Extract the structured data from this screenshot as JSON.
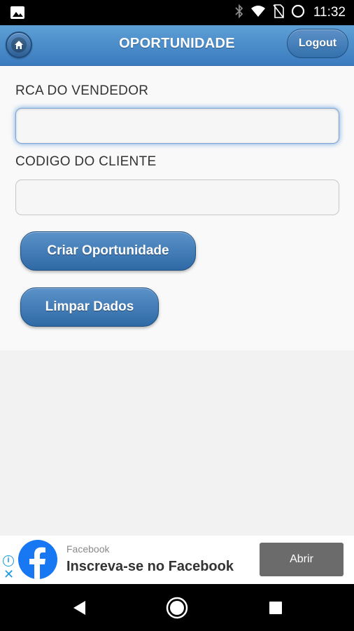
{
  "status_bar": {
    "time": "11:32",
    "icons": [
      "image-icon",
      "bluetooth-icon",
      "wifi-icon",
      "no-sim-icon",
      "battery-saver-icon"
    ]
  },
  "header": {
    "title": "OPORTUNIDADE",
    "logout_label": "Logout",
    "home_icon": "home-icon",
    "color_top": "#5d9fd5",
    "color_bottom": "#3b7bbf"
  },
  "form": {
    "rca_label": "RCA DO VENDEDOR",
    "rca_value": "",
    "cliente_label": "CODIGO DO CLIENTE",
    "cliente_value": ""
  },
  "buttons": {
    "criar_label": "Criar Oportunidade",
    "limpar_label": "Limpar Dados"
  },
  "ad": {
    "advertiser": "Facebook",
    "headline": "Inscreva-se no Facebook",
    "cta_label": "Abrir",
    "info_icon": "info-icon",
    "close_icon": "close-icon",
    "brand_color": "#1877f2"
  },
  "nav": {
    "icons": [
      "back-icon",
      "home-circle-icon",
      "recents-icon"
    ]
  }
}
